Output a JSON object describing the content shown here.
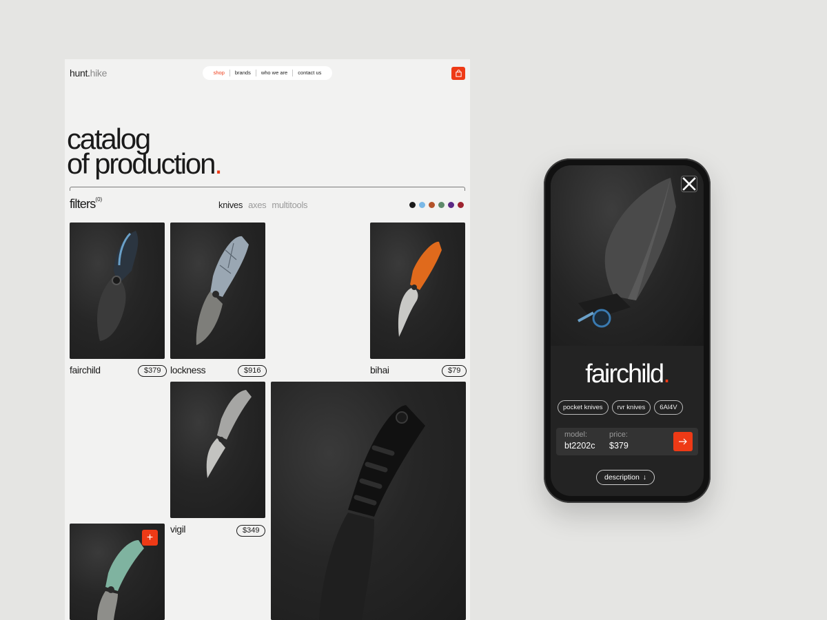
{
  "site": {
    "logo_bold": "hunt.",
    "logo_light": "hike",
    "nav": [
      "shop",
      "brands",
      "who we are",
      "contact us"
    ]
  },
  "hero": {
    "line1": "catalog",
    "line2": "of production",
    "dot": "."
  },
  "filters": {
    "label": "filters",
    "count": "(0)"
  },
  "categories": [
    {
      "label": "knives",
      "active": true
    },
    {
      "label": "axes",
      "active": false
    },
    {
      "label": "multitools",
      "active": false
    }
  ],
  "swatches": [
    "#1a1a1a",
    "#7ab8e6",
    "#b4532a",
    "#5e8a6a",
    "#5b2a86",
    "#9e2430"
  ],
  "products": [
    {
      "name": "fairchild",
      "price": "$379",
      "handle": "#2b3540",
      "blade": "#3b3b3b"
    },
    {
      "name": "lockness",
      "price": "$916",
      "handle": "#9aa7b3",
      "blade": "#7e7e7a"
    },
    {
      "name": "bihai",
      "price": "$79",
      "handle": "#e06a1c",
      "blade": "#c9c9c6"
    },
    {
      "name": "vigil",
      "price": "$349",
      "handle": "#a6a6a4",
      "blade": "#c3c3c0"
    },
    {
      "name": "",
      "price": "",
      "handle": "#111111",
      "blade": "#1f1f1f"
    },
    {
      "name": "",
      "price": "",
      "handle": "#7fb3a0",
      "blade": "#8e8e8a"
    }
  ],
  "add_symbol": "+",
  "mobile": {
    "title": "fairchild",
    "dot": ".",
    "tags": [
      "pocket knives",
      "rvr knives",
      "6Al4V"
    ],
    "model_label": "model:",
    "model_value": "bt2202c",
    "price_label": "price:",
    "price_value": "$379",
    "description_label": "description",
    "arrow_down": "↓"
  },
  "colors": {
    "accent": "#ee3a16",
    "page_bg": "#e5e5e3",
    "panel_bg": "#f2f2f1",
    "phone_bg": "#232323"
  },
  "icons": [
    "bag-icon",
    "plus-icon",
    "close-icon",
    "arrow-right-icon",
    "arrow-down-icon"
  ]
}
